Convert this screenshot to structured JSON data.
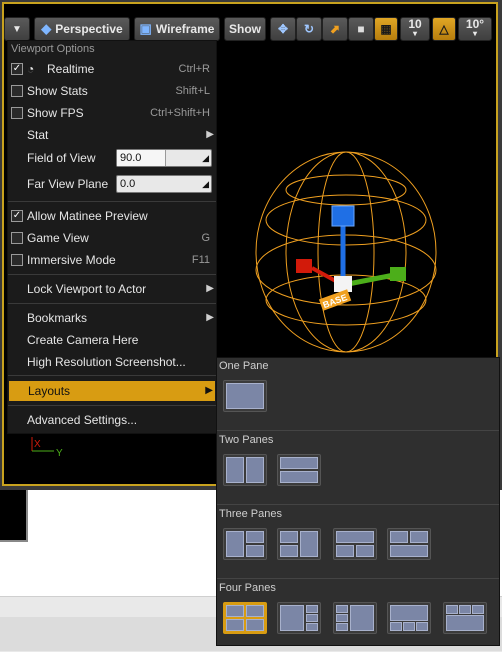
{
  "toolbar": {
    "perspective_label": "Perspective",
    "wireframe_label": "Wireframe",
    "show_label": "Show",
    "grid_snap_value": "10",
    "rotation_snap_value": "10°"
  },
  "menu": {
    "header": "Viewport Options",
    "realtime": {
      "label": "Realtime",
      "shortcut": "Ctrl+R",
      "checked": true
    },
    "show_stats": {
      "label": "Show Stats",
      "shortcut": "Shift+L",
      "checked": false
    },
    "show_fps": {
      "label": "Show FPS",
      "shortcut": "Ctrl+Shift+H",
      "checked": false
    },
    "stat": {
      "label": "Stat"
    },
    "field_of_view": {
      "label": "Field of View",
      "value": "90.0"
    },
    "far_view_plane": {
      "label": "Far View Plane",
      "value": "0.0"
    },
    "allow_matinee": {
      "label": "Allow Matinee Preview",
      "checked": true
    },
    "game_view": {
      "label": "Game View",
      "shortcut": "G",
      "checked": false
    },
    "immersive": {
      "label": "Immersive Mode",
      "shortcut": "F11",
      "checked": false
    },
    "lock_viewport": {
      "label": "Lock Viewport to Actor"
    },
    "bookmarks": {
      "label": "Bookmarks"
    },
    "create_camera": {
      "label": "Create Camera Here"
    },
    "high_res": {
      "label": "High Resolution Screenshot..."
    },
    "layouts": {
      "label": "Layouts"
    },
    "advanced": {
      "label": "Advanced Settings..."
    }
  },
  "axis": {
    "x_label": "X",
    "y_label": "Y"
  },
  "layouts_menu": {
    "one_pane": "One Pane",
    "two_panes": "Two Panes",
    "three_panes": "Three Panes",
    "four_panes": "Four Panes"
  },
  "scene": {
    "tag_text": "BASE"
  },
  "colors": {
    "accent": "#d89c12",
    "menu_bg": "#1b1b1b",
    "submenu_bg": "#2f2f2f",
    "pane_fill": "#7b86a6",
    "gizmo_x": "#d21a0a",
    "gizmo_y": "#4cae1a",
    "gizmo_z": "#1f6fe5",
    "wire": "#f0a020"
  }
}
